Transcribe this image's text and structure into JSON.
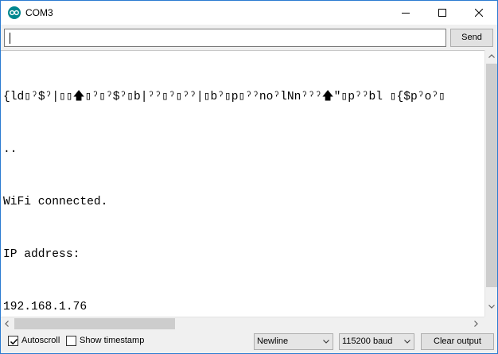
{
  "window": {
    "title": "COM3"
  },
  "send": {
    "input_value": "",
    "button_label": "Send"
  },
  "output": {
    "lines": [
      "{ld▯ˀ$ˀ|▯▯🡅▯ˀ▯ˀ$ˀ▯b|ˀˀ▯ˀ▯ˀˀ|▯bˀ▯p▯ˀˀnoˀlNnˀˀˀ🡅\"▯pˀˀbl ▯{$pˀoˀ▯",
      "..",
      "WiFi connected.",
      "IP address:",
      "192.168.1.76"
    ]
  },
  "bottom": {
    "autoscroll": {
      "label": "Autoscroll",
      "checked": true
    },
    "timestamp": {
      "label": "Show timestamp",
      "checked": false
    },
    "line_ending": "Newline",
    "baud": "115200 baud",
    "clear_label": "Clear output"
  },
  "icons": {
    "app": "arduino-icon",
    "minimize": "minimize-icon",
    "maximize": "maximize-icon",
    "close": "close-icon"
  }
}
